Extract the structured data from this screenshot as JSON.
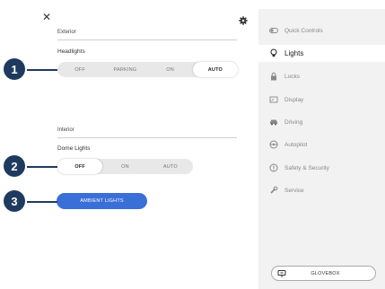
{
  "header": {
    "close_symbol": "✕",
    "settings_icon": "gear-icon"
  },
  "exterior": {
    "section_label": "Exterior",
    "headlights": {
      "label": "Headlights",
      "options": [
        "OFF",
        "PARKING",
        "ON",
        "AUTO"
      ],
      "selected": "AUTO"
    }
  },
  "interior": {
    "section_label": "Interior",
    "dome_lights": {
      "label": "Dome Lights",
      "options": [
        "OFF",
        "ON",
        "AUTO"
      ],
      "selected": "OFF"
    },
    "ambient_button": "AMBIENT LIGHTS"
  },
  "callouts": [
    "1",
    "2",
    "3"
  ],
  "nav": {
    "items": [
      {
        "label": "Quick Controls",
        "icon": "toggle-icon",
        "active": false
      },
      {
        "label": "Lights",
        "icon": "bulb-icon",
        "active": true
      },
      {
        "label": "Locks",
        "icon": "lock-icon",
        "active": false
      },
      {
        "label": "Display",
        "icon": "display-icon",
        "active": false
      },
      {
        "label": "Driving",
        "icon": "car-icon",
        "active": false
      },
      {
        "label": "Autopilot",
        "icon": "steering-wheel-icon",
        "active": false
      },
      {
        "label": "Safety & Security",
        "icon": "alert-icon",
        "active": false
      },
      {
        "label": "Service",
        "icon": "wrench-icon",
        "active": false
      }
    ],
    "glovebox": {
      "label": "GLOVEBOX",
      "icon": "glovebox-icon"
    }
  },
  "colors": {
    "accent": "#3a6fd8",
    "callout": "#1f3a5f",
    "panel": "#f2f2f2"
  }
}
